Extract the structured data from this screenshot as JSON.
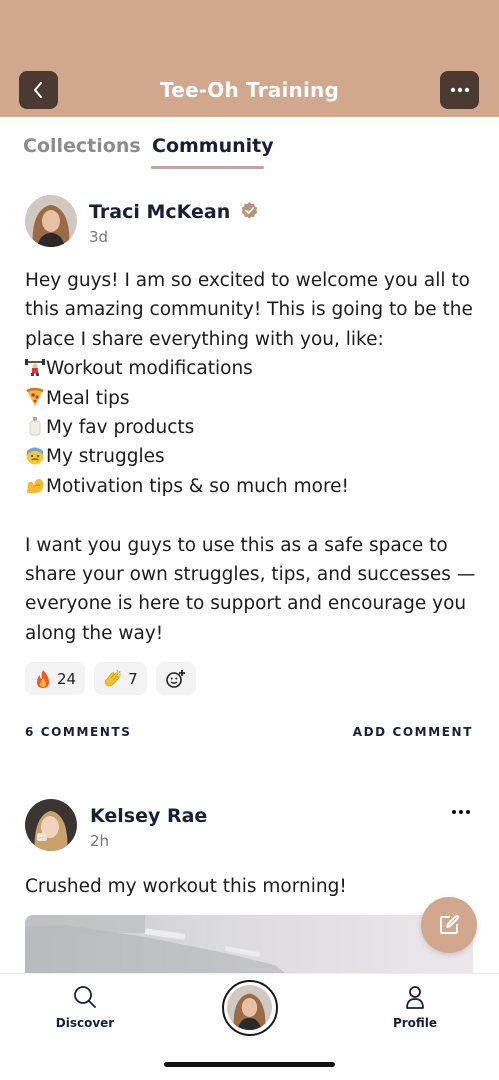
{
  "header": {
    "title": "Tee-Oh Training",
    "back_icon": "chevron-left-icon",
    "more_icon": "ellipsis-icon",
    "background_color": "#d1a78e"
  },
  "tabs": [
    {
      "label": "Collections",
      "active": false
    },
    {
      "label": "Community",
      "active": true
    }
  ],
  "post1": {
    "author": "Traci McKean",
    "verified_icon": "verified-badge-icon",
    "time": "3d",
    "lines": [
      "Hey guys! I am so excited to welcome you all to",
      "this amazing community! This is going to be the",
      "place I share everything with you, like:",
      "Workout modifications",
      "Meal tips",
      "My fav products",
      "My struggles",
      "Motivation tips & so much more!",
      "",
      "I want you guys to use this as a safe space to",
      "share your own struggles, tips, and successes —",
      "everyone is here to support and encourage you",
      "along the way!"
    ],
    "reactions": [
      {
        "icon": "fire-emoji",
        "count": "24"
      },
      {
        "icon": "clap-emoji",
        "count": "7"
      }
    ],
    "add_reaction_icon": "add-reaction-icon",
    "comments_label": "6 COMMENTS",
    "add_comment_label": "ADD COMMENT"
  },
  "post2": {
    "author": "Kelsey Rae",
    "time": "2h",
    "text": "Crushed my workout this morning!",
    "more_icon": "ellipsis-icon"
  },
  "fab": {
    "icon": "compose-icon"
  },
  "bottom_nav": {
    "discover_label": "Discover",
    "profile_label": "Profile",
    "discover_icon": "search-icon",
    "profile_icon": "person-icon"
  }
}
